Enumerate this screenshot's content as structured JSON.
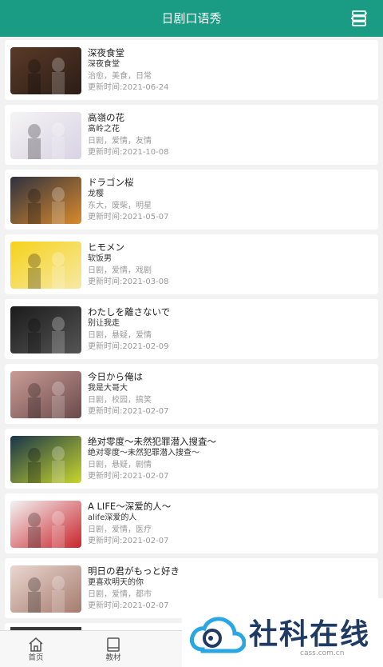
{
  "header": {
    "title": "日剧口语秀"
  },
  "items": [
    {
      "title": "深夜食堂",
      "subtitle": "深夜食堂",
      "tags": "治愈，美食，日常",
      "updated": "更新时间:2021-06-24",
      "thumb_colors": [
        "#5a3a28",
        "#2b1d16"
      ]
    },
    {
      "title": "高嶺の花",
      "subtitle": "高岭之花",
      "tags": "日剧，爱情，友情",
      "updated": "更新时间:2021-10-08",
      "thumb_colors": [
        "#f4f4f4",
        "#d9d2e4"
      ]
    },
    {
      "title": "ドラゴン桜",
      "subtitle": "龙樱",
      "tags": "东大，废柴，明星",
      "updated": "更新时间:2021-05-07",
      "thumb_colors": [
        "#2e3140",
        "#d98a2b"
      ]
    },
    {
      "title": "ヒモメン",
      "subtitle": "软饭男",
      "tags": "日剧，爱情，戏剧",
      "updated": "更新时间:2021-03-08",
      "thumb_colors": [
        "#f5d21a",
        "#f7e9a5"
      ]
    },
    {
      "title": "わたしを離さないで",
      "subtitle": "别让我走",
      "tags": "日剧，悬疑，爱情",
      "updated": "更新时间:2021-02-09",
      "thumb_colors": [
        "#1b1b1b",
        "#555555"
      ]
    },
    {
      "title": "今日から俺は",
      "subtitle": "我是大哥大",
      "tags": "日剧，校园，搞笑",
      "updated": "更新时间:2021-02-07",
      "thumb_colors": [
        "#c99c96",
        "#6b4a4a"
      ]
    },
    {
      "title": "绝对零度～未然犯罪潜入搜査～",
      "subtitle": "绝对零度～未然犯罪潜入搜查～",
      "tags": "日剧，悬疑，剧情",
      "updated": "更新时间:2021-02-07",
      "thumb_colors": [
        "#18344a",
        "#c8d62c"
      ]
    },
    {
      "title": "A LIFE～深爱的人～",
      "subtitle": "alife深爱的人",
      "tags": "日剧，爱情，医疗",
      "updated": "更新时间:2021-02-07",
      "thumb_colors": [
        "#f3f3f3",
        "#c9252c"
      ]
    },
    {
      "title": "明日の君がもっと好き",
      "subtitle": "更喜欢明天的你",
      "tags": "日剧，爱情，都市",
      "updated": "更新时间:2021-02-07",
      "thumb_colors": [
        "#ead7d0",
        "#a67b6e"
      ]
    }
  ],
  "partial_item": {
    "title": "…"
  },
  "tabbar": {
    "home_label": "首页",
    "materials_label": "教材"
  },
  "watermark": {
    "brand": "社科在线",
    "url": "cass.com.cn"
  },
  "colors": {
    "accent": "#1a9c84",
    "brand_blue": "#1f3b63",
    "logo_blue": "#2aa7e2"
  }
}
